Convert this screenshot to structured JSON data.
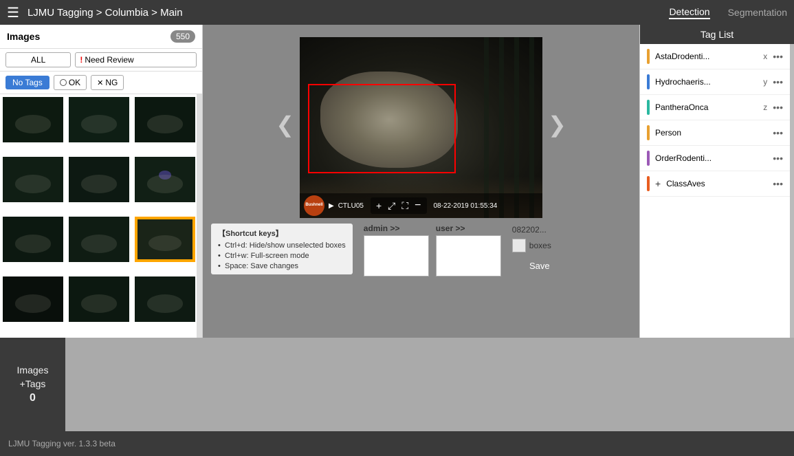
{
  "topbar": {
    "menu_icon": "☰",
    "title": "LJMU Tagging > Columbia > Main",
    "nav": {
      "detection": "Detection",
      "segmentation": "Segmentation"
    }
  },
  "sidebar": {
    "header": {
      "label": "Images",
      "count": "550"
    },
    "filters": {
      "all": "ALL",
      "need_review": "Need Review",
      "need_review_prefix": "!",
      "no_tags": "No Tags",
      "ok": "OK",
      "ng": "NG"
    }
  },
  "viewer": {
    "nav_left": "❮",
    "nav_right": "❯",
    "bushnell_text": "Bushnell",
    "cam_id": "CTLU05",
    "timestamp": "08-22-2019  01:55:34",
    "toolbar": {
      "zoom_in": "+",
      "fit": "⤢",
      "fullscreen": "⛶",
      "zoom_out": "−"
    }
  },
  "shortcuts": {
    "title": "【Shortcut keys】",
    "items": [
      "Ctrl+d: Hide/show unselected boxes",
      "Ctrl+w: Full-screen mode",
      "Space: Save changes"
    ]
  },
  "admin_user": {
    "admin_label": "admin >>",
    "user_label": "user >>",
    "file_info": "082202...",
    "boxes_label": "boxes",
    "save_label": "Save"
  },
  "tag_list": {
    "header": "Tag List",
    "tags": [
      {
        "name": "AstaDrodenti...",
        "key": "x",
        "color": "#e8a030",
        "show_more": true,
        "show_plus": false
      },
      {
        "name": "Hydrochaeris...",
        "key": "y",
        "color": "#3a7bd5",
        "show_more": true,
        "show_plus": false
      },
      {
        "name": "PantheraOnca",
        "key": "z",
        "color": "#2ab8a0",
        "show_more": true,
        "show_plus": false
      },
      {
        "name": "Person",
        "key": "",
        "color": "#e8a030",
        "show_more": true,
        "show_plus": false
      },
      {
        "name": "OrderRodenti...",
        "key": "",
        "color": "#9b59b6",
        "show_more": true,
        "show_plus": false
      },
      {
        "name": "ClassAves",
        "key": "",
        "color": "#e85d20",
        "show_more": true,
        "show_plus": true
      }
    ]
  },
  "bottom": {
    "images_label": "Images",
    "tags_label": "+Tags",
    "count": "0"
  },
  "footer": {
    "version": "LJMU Tagging ver. 1.3.3 beta"
  }
}
